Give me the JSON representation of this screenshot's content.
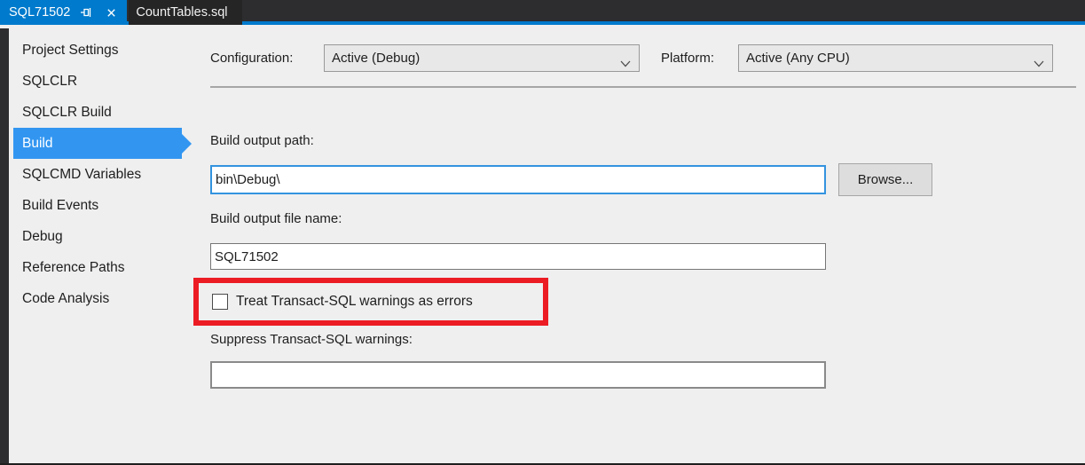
{
  "window": {
    "tabs": [
      {
        "label": "SQL71502",
        "state": "active"
      },
      {
        "label": "CountTables.sql",
        "state": "inactive"
      }
    ]
  },
  "icons": {
    "pin-icon": "horizontal-pushpin",
    "close-icon": "x-cross",
    "chevron-down-icon": "chevron-down"
  },
  "sidebar": {
    "items": [
      {
        "label": "Project Settings",
        "selected": false
      },
      {
        "label": "SQLCLR",
        "selected": false
      },
      {
        "label": "SQLCLR Build",
        "selected": false
      },
      {
        "label": "Build",
        "selected": true
      },
      {
        "label": "SQLCMD Variables",
        "selected": false
      },
      {
        "label": "Build Events",
        "selected": false
      },
      {
        "label": "Debug",
        "selected": false
      },
      {
        "label": "Reference Paths",
        "selected": false
      },
      {
        "label": "Code Analysis",
        "selected": false
      }
    ]
  },
  "toolbar": {
    "configuration_label": "Configuration:",
    "configuration_value": "Active (Debug)",
    "platform_label": "Platform:",
    "platform_value": "Active (Any CPU)"
  },
  "form": {
    "build_output_path_label": "Build output path:",
    "build_output_path_value": "bin\\Debug\\",
    "browse_label": "Browse...",
    "build_output_file_name_label": "Build output file name:",
    "build_output_file_name_value": "SQL71502",
    "treat_warnings_label": "Treat Transact-SQL warnings as errors",
    "treat_warnings_checked": false,
    "suppress_warnings_label": "Suppress Transact-SQL warnings:",
    "suppress_warnings_value": ""
  },
  "colors": {
    "accent_blue": "#007ACC",
    "sidebar_selection_blue": "#3296F1",
    "focused_input_border": "#3393DF",
    "annotation_red": "#EC1C24",
    "tabbar_background": "#2D2D30",
    "page_background": "#EFEFF0"
  }
}
